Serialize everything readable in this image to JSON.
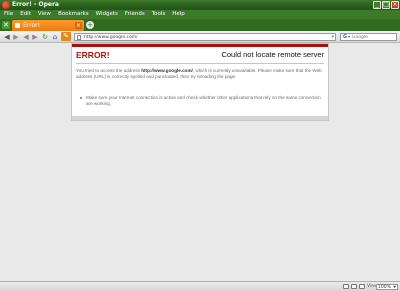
{
  "window": {
    "title": "Error! - Opera"
  },
  "menu": {
    "items": [
      "File",
      "Edit",
      "View",
      "Bookmarks",
      "Widgets",
      "Friends",
      "Tools",
      "Help"
    ]
  },
  "tab": {
    "label": "Error!"
  },
  "address": {
    "url": "http://www.google.com/"
  },
  "search": {
    "placeholder": "Google"
  },
  "error_page": {
    "title": "ERROR!",
    "heading": "Could not locate remote server",
    "message_before": "You tried to access the address ",
    "message_address": "http://www.google.com/",
    "message_after": ", which is currently unavailable. Please make sure that the Web address (URL) is correctly spelled and punctuated, then try reloading the page.",
    "tip": "Make sure your Internet connection is active and check whether other applications that rely on the same connection are working."
  },
  "status": {
    "view_label": "View",
    "zoom": "100%"
  },
  "colors": {
    "chrome_green": "#2f6b21",
    "tab_orange": "#f07a10",
    "error_red": "#a8100c"
  }
}
